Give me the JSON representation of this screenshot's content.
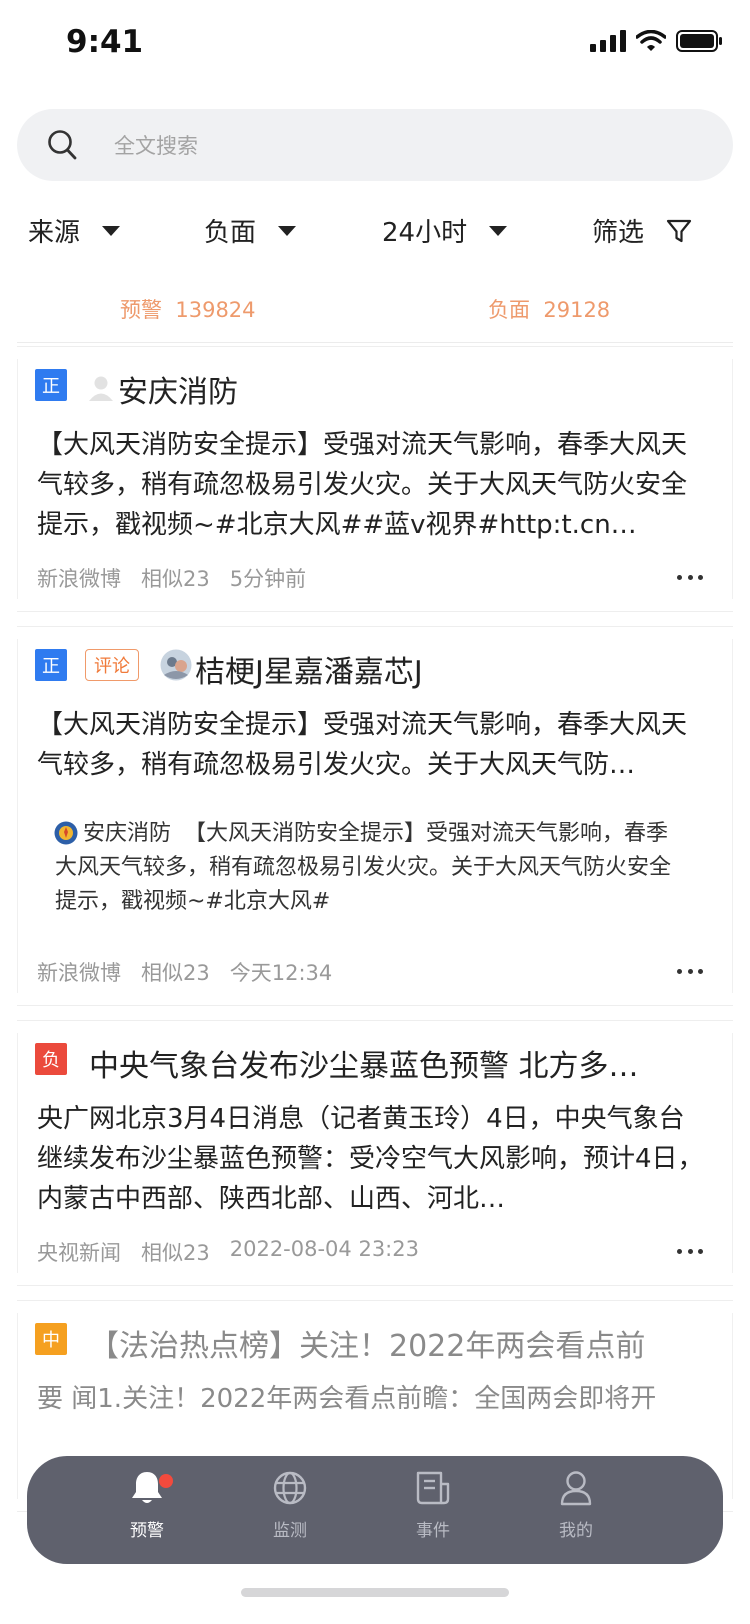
{
  "status": {
    "time": "9:41"
  },
  "search": {
    "placeholder": "全文搜索"
  },
  "filters": {
    "source": "来源",
    "sentiment": "负面",
    "range": "24小时",
    "screen": "筛选"
  },
  "stats": {
    "alert_label": "预警",
    "alert_count": "139824",
    "neg_label": "负面",
    "neg_count": "29128"
  },
  "cards": [
    {
      "tag": "正",
      "author": "安庆消防",
      "body": "【大风天消防安全提示】受强对流天气影响，春季大风天气较多，稍有疏忽极易引发火灾。关于大风天气防火安全提示，戳视频~#北京大风##蓝v视界#http:t.cn…",
      "source": "新浪微博",
      "similar": "相似23",
      "time": "5分钟前"
    },
    {
      "tag": "正",
      "subtag": "评论",
      "author": "桔梗J星嘉潘嘉芯J",
      "body": "【大风天消防安全提示】受强对流天气影响，春季大风天气较多，稍有疏忽极易引发火灾。关于大风天气防…",
      "quote_author": "安庆消防",
      "quote": "【大风天消防安全提示】受强对流天气影响，春季大风天气较多，稍有疏忽极易引发火灾。关于大风天气防火安全提示，戳视频~#北京大风#",
      "source": "新浪微博",
      "similar": "相似23",
      "time": "今天12:34"
    },
    {
      "tag": "负",
      "title": "中央气象台发布沙尘暴蓝色预警 北方多…",
      "body": "央广网北京3月4日消息（记者黄玉玲）4日，中央气象台继续发布沙尘暴蓝色预警：受冷空气大风影响，预计4日，内蒙古中西部、陕西北部、山西、河北…",
      "source": "央视新闻",
      "similar": "相似23",
      "time": "2022-08-04  23:23"
    },
    {
      "tag": "中",
      "title": "【法治热点榜】关注！2022年两会看点前",
      "body": "要 闻1.关注！2022年两会看点前瞻：全国两会即将开"
    }
  ],
  "tabbar": {
    "tab1": "预警",
    "tab2": "监测",
    "tab3": "事件",
    "tab4": "我的"
  },
  "colors": {
    "accent": "#ee9a6c",
    "tag_positive": "#2f7bf0",
    "tag_negative": "#eb4a3c",
    "tag_neutral": "#f5a020",
    "tabbar_bg": "#5f616d"
  }
}
